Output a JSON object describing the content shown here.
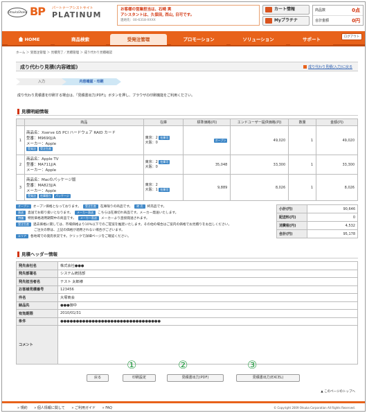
{
  "header": {
    "logo_small": "OtsukaShokai",
    "logo_bp": "BP",
    "logo_sub": "パートナーアシストサイト",
    "logo_platinum": "PLATINUM",
    "notice_line1": "お客様の営業担当は、石崎 実",
    "notice_line2": "アシスタントは、久保田, 西山, 日可です。",
    "notice_line3": "連絡先：00-6318-XXXX",
    "cart_label": "カート情報",
    "myplatinum_label": "Myプラチナ",
    "summary_items_label": "商品数",
    "summary_items_value": "0点",
    "summary_total_label": "合計金額",
    "summary_total_value": "0円"
  },
  "nav": {
    "tabs": [
      "HOME",
      "商品検索",
      "受発注管理",
      "プロモーション",
      "ソリューション",
      "サポート"
    ],
    "logout": "ログアウト"
  },
  "breadcrumb": "ホーム ＞ 受発注管理 ＞ 見積完了／見積管理 ＞ 成り代わり見積確認",
  "page": {
    "title": "成り代わり見積(内容確認)",
    "back_link": "成り代わり見積(入力)に戻る",
    "steps": [
      "入力",
      "内容確認・印刷"
    ],
    "instruction": "成り代わり見積書を印刷する場合は、「見積書出力(PDF)」ボタンを押し、ブラウザの印刷機能をご利用ください。"
  },
  "items_section": {
    "heading": "見積明細情報",
    "columns": [
      "",
      "商品",
      "在庫",
      "標準価格(円)",
      "エンドユーザー提供価格(円)",
      "数量",
      "金額(円)"
    ],
    "rows": [
      {
        "no": "1",
        "name": "商品名：Xserve G5 PCI ハードウェア RAID カード",
        "model": "型番：M9690J/A",
        "maker": "メーカー：Apple",
        "tags": [
          "受発注",
          "受注生産"
        ],
        "stock1": "東京：2",
        "stock2": "大阪：0",
        "stock_tag": "在庫可",
        "std_price": "オープン",
        "eu_price": "49,020",
        "qty": "1",
        "amount": "49,020"
      },
      {
        "no": "2",
        "name": "商品名：Apple TV",
        "model": "型番：MA711J/A",
        "maker": "メーカー：Apple",
        "tags": [],
        "stock1": "東京：2",
        "stock2": "大阪：0",
        "stock_tag": "在庫可",
        "std_price": "35,048",
        "eu_price": "33,300",
        "qty": "1",
        "amount": "33,300"
      },
      {
        "no": "3",
        "name": "商品名：Macのパッケージ版",
        "model": "型番：MA823J/A",
        "maker": "メーカー：Apple",
        "tags": [
          "受発注",
          "在庫限り",
          "パッケージ"
        ],
        "stock1": "東京：2",
        "stock2": "大阪：1",
        "stock_tag": "在庫可",
        "std_price": "9,889",
        "eu_price": "8,026",
        "qty": "1",
        "amount": "8,026"
      }
    ]
  },
  "legend": [
    {
      "tag": "オープン",
      "text": "オープン価格となっております。",
      "tag2": "受注生産",
      "text2": "在庫限りの商品です。",
      "tag3": "終 売",
      "text3": "終売品です。"
    },
    {
      "tag": "直送",
      "text": "直送でお取り扱いとなります。",
      "tag2": "メーカー直送",
      "text2": "こちらは在庫切れ商品です。メーカー発送いたします。"
    },
    {
      "tag": "特価",
      "text": "特別価格適用期間中の商品です。",
      "tag2": "メーカー直送",
      "text2": "メーカーより直接発送されます。"
    },
    {
      "tag": "受注生産",
      "text": "過去価格に関しては、市場価格より10%以下でのご提案を推奨いたします。その他の場合はご案内の価格でお見積りをお出しください。"
    },
    {
      "tag": "",
      "text": "ご注文の際は、上記の価格が適用されない場合がございます。"
    },
    {
      "tag": "エリア",
      "text": "各地域での発売状況です。クリックで詳細ページをご確認ください。"
    }
  ],
  "totals": [
    {
      "label": "小計(円)",
      "value": "90,646"
    },
    {
      "label": "配送料(円)",
      "value": "0"
    },
    {
      "label": "消費税(円)",
      "value": "4,532"
    },
    {
      "label": "合計(円)",
      "value": "95,178"
    }
  ],
  "header_section": {
    "heading": "見積ヘッダー情報",
    "rows": [
      {
        "label": "発先会社名",
        "value": "株式会社●●●"
      },
      {
        "label": "発先部署名",
        "value": "システム統括部"
      },
      {
        "label": "発先担当者名",
        "value": "テスト 太郎様"
      },
      {
        "label": "お客様見積番号",
        "value": "123456"
      },
      {
        "label": "件名",
        "value": "大塚商会"
      },
      {
        "label": "納品先",
        "value": "●●●御中"
      },
      {
        "label": "有効期限",
        "value": "2010/01/31"
      },
      {
        "label": "条件",
        "value": "●●●●●●●●●●●●●●●●●●●●●●●●●●●●●●●●"
      },
      {
        "label": "コメント",
        "value": ""
      }
    ]
  },
  "buttons": {
    "back": "戻る",
    "print_settings": "印刷設定",
    "pdf": "見積書出力(PDF)",
    "excel": "見積書出力(EXCEL)",
    "circ1": "①",
    "circ2": "②",
    "circ3": "③",
    "top_link": "▲ このページのトップへ"
  },
  "footer": {
    "links": [
      "» 規約",
      "» 個人情報に関して",
      "» ご利用ガイド",
      "» FAQ"
    ],
    "copyright": "© Copyright 2009 Otsuka Corporation All Rights Reserved."
  },
  "colors": {
    "brand": "#e8621a",
    "accent_red": "#d2330c",
    "tag_blue": "#3e87c7",
    "circle_green": "#2e9e4a"
  }
}
